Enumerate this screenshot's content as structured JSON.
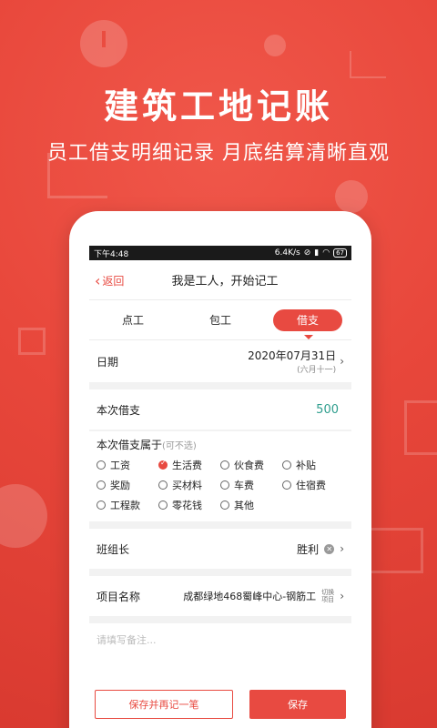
{
  "promo": {
    "headline": "建筑工地记账",
    "subline": "员工借支明细记录 月底结算清晰直观"
  },
  "status": {
    "time": "下午4:48",
    "speed": "6.4K/s",
    "battery": "67"
  },
  "nav": {
    "back_label": "返回",
    "title": "我是工人，开始记工"
  },
  "tabs": [
    {
      "label": "点工"
    },
    {
      "label": "包工"
    },
    {
      "label": "借支"
    }
  ],
  "form": {
    "date_label": "日期",
    "date_value": "2020年07月31日",
    "lunar_value": "(六月十一)",
    "amount_label": "本次借支",
    "amount_value": "500",
    "category_title": "本次借支属于",
    "category_note": "(可不选)",
    "categories": [
      {
        "label": "工资",
        "checked": false
      },
      {
        "label": "生活费",
        "checked": true
      },
      {
        "label": "伙食费",
        "checked": false
      },
      {
        "label": "补贴",
        "checked": false
      },
      {
        "label": "奖励",
        "checked": false
      },
      {
        "label": "买材料",
        "checked": false
      },
      {
        "label": "车费",
        "checked": false
      },
      {
        "label": "住宿费",
        "checked": false
      },
      {
        "label": "工程款",
        "checked": false
      },
      {
        "label": "零花钱",
        "checked": false
      },
      {
        "label": "其他",
        "checked": false
      }
    ],
    "leader_label": "班组长",
    "leader_value": "胜利",
    "project_label": "项目名称",
    "project_value": "成都绿地468蜀峰中心-钢筋工",
    "switch_project": "切换项目",
    "remark_placeholder": "请填写备注..."
  },
  "buttons": {
    "save_again": "保存并再记一笔",
    "save": "保存"
  },
  "colors": {
    "accent": "#e84a41",
    "amount": "#2f9e8e"
  }
}
